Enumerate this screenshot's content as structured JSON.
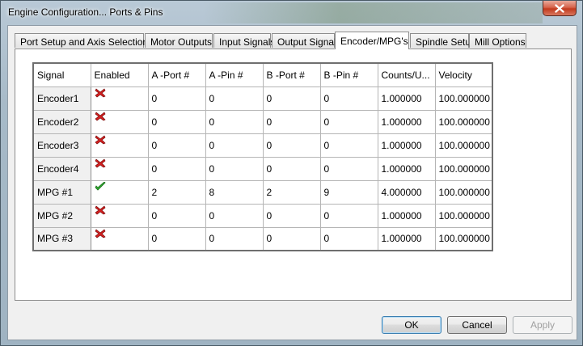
{
  "window": {
    "title": "Engine Configuration... Ports & Pins"
  },
  "tabs": [
    {
      "label": "Port Setup and Axis Selection",
      "active": false
    },
    {
      "label": "Motor Outputs",
      "active": false
    },
    {
      "label": "Input Signals",
      "active": false
    },
    {
      "label": "Output Signals",
      "active": false
    },
    {
      "label": "Encoder/MPG's",
      "active": true
    },
    {
      "label": "Spindle Setup",
      "active": false
    },
    {
      "label": "Mill Options",
      "active": false
    }
  ],
  "grid": {
    "columns": [
      "Signal",
      "Enabled",
      "A -Port #",
      "A -Pin  #",
      "B -Port #",
      "B -Pin  #",
      "Counts/U...",
      "Velocity"
    ],
    "rows": [
      {
        "signal": "Encoder1",
        "enabled": false,
        "a_port": "0",
        "a_pin": "0",
        "b_port": "0",
        "b_pin": "0",
        "counts": "1.000000",
        "velocity": "100.000000"
      },
      {
        "signal": "Encoder2",
        "enabled": false,
        "a_port": "0",
        "a_pin": "0",
        "b_port": "0",
        "b_pin": "0",
        "counts": "1.000000",
        "velocity": "100.000000"
      },
      {
        "signal": "Encoder3",
        "enabled": false,
        "a_port": "0",
        "a_pin": "0",
        "b_port": "0",
        "b_pin": "0",
        "counts": "1.000000",
        "velocity": "100.000000"
      },
      {
        "signal": "Encoder4",
        "enabled": false,
        "a_port": "0",
        "a_pin": "0",
        "b_port": "0",
        "b_pin": "0",
        "counts": "1.000000",
        "velocity": "100.000000"
      },
      {
        "signal": "MPG #1",
        "enabled": true,
        "a_port": "2",
        "a_pin": "8",
        "b_port": "2",
        "b_pin": "9",
        "counts": "4.000000",
        "velocity": "100.000000"
      },
      {
        "signal": "MPG #2",
        "enabled": false,
        "a_port": "0",
        "a_pin": "0",
        "b_port": "0",
        "b_pin": "0",
        "counts": "1.000000",
        "velocity": "100.000000"
      },
      {
        "signal": "MPG #3",
        "enabled": false,
        "a_port": "0",
        "a_pin": "0",
        "b_port": "0",
        "b_pin": "0",
        "counts": "1.000000",
        "velocity": "100.000000"
      }
    ]
  },
  "buttons": {
    "ok": "OK",
    "cancel": "Cancel",
    "apply": "Apply"
  },
  "colors": {
    "disabled_mark": "#d42020",
    "enabled_mark": "#2fae2f"
  }
}
